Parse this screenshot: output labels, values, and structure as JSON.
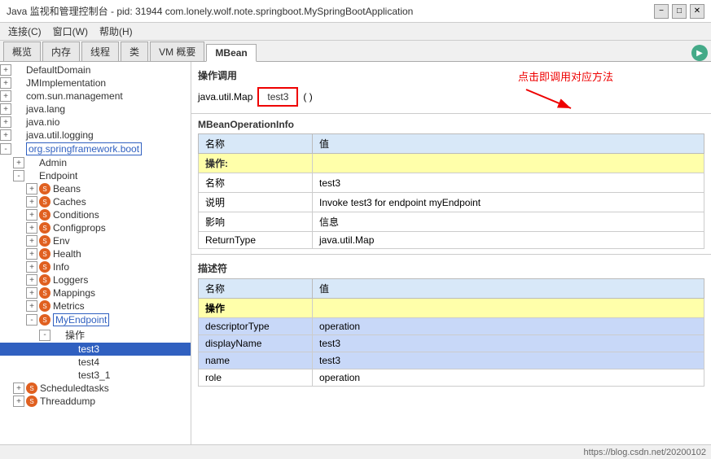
{
  "titleBar": {
    "title": "Java 监视和管理控制台 - pid: 31944 com.lonely.wolf.note.springboot.MySpringBootApplication",
    "minBtn": "−",
    "maxBtn": "□",
    "closeBtn": "✕"
  },
  "menuBar": {
    "items": [
      {
        "label": "连接(C)",
        "id": "connect"
      },
      {
        "label": "窗口(W)",
        "id": "window"
      },
      {
        "label": "帮助(H)",
        "id": "help"
      }
    ]
  },
  "tabs": [
    {
      "label": "概览",
      "id": "overview",
      "active": false
    },
    {
      "label": "内存",
      "id": "memory",
      "active": false
    },
    {
      "label": "线程",
      "id": "threads",
      "active": false
    },
    {
      "label": "类",
      "id": "classes",
      "active": false
    },
    {
      "label": "VM 概要",
      "id": "vm",
      "active": false
    },
    {
      "label": "MBean",
      "id": "mbean",
      "active": true
    }
  ],
  "sidebar": {
    "nodes": [
      {
        "id": "n1",
        "indent": 0,
        "toggle": "+",
        "icon": false,
        "label": "DefaultDomain",
        "selected": false,
        "boxed": false
      },
      {
        "id": "n2",
        "indent": 0,
        "toggle": "+",
        "icon": false,
        "label": "JMImplementation",
        "selected": false,
        "boxed": false
      },
      {
        "id": "n3",
        "indent": 0,
        "toggle": "+",
        "icon": false,
        "label": "com.sun.management",
        "selected": false,
        "boxed": false
      },
      {
        "id": "n4",
        "indent": 0,
        "toggle": "+",
        "icon": false,
        "label": "java.lang",
        "selected": false,
        "boxed": false
      },
      {
        "id": "n5",
        "indent": 0,
        "toggle": "+",
        "icon": false,
        "label": "java.nio",
        "selected": false,
        "boxed": false
      },
      {
        "id": "n6",
        "indent": 0,
        "toggle": "+",
        "icon": false,
        "label": "java.util.logging",
        "selected": false,
        "boxed": false
      },
      {
        "id": "n7",
        "indent": 0,
        "toggle": "-",
        "icon": false,
        "label": "org.springframework.boot",
        "selected": false,
        "boxed": true
      },
      {
        "id": "n8",
        "indent": 1,
        "toggle": "+",
        "icon": false,
        "label": "Admin",
        "selected": false,
        "boxed": false
      },
      {
        "id": "n9",
        "indent": 1,
        "toggle": "-",
        "icon": false,
        "label": "Endpoint",
        "selected": false,
        "boxed": false
      },
      {
        "id": "n10",
        "indent": 2,
        "toggle": "+",
        "icon": true,
        "label": "Beans",
        "selected": false,
        "boxed": false
      },
      {
        "id": "n11",
        "indent": 2,
        "toggle": "+",
        "icon": true,
        "label": "Caches",
        "selected": false,
        "boxed": false
      },
      {
        "id": "n12",
        "indent": 2,
        "toggle": "+",
        "icon": true,
        "label": "Conditions",
        "selected": false,
        "boxed": false
      },
      {
        "id": "n13",
        "indent": 2,
        "toggle": "+",
        "icon": true,
        "label": "Configprops",
        "selected": false,
        "boxed": false
      },
      {
        "id": "n14",
        "indent": 2,
        "toggle": "+",
        "icon": true,
        "label": "Env",
        "selected": false,
        "boxed": false
      },
      {
        "id": "n15",
        "indent": 2,
        "toggle": "+",
        "icon": true,
        "label": "Health",
        "selected": false,
        "boxed": false
      },
      {
        "id": "n16",
        "indent": 2,
        "toggle": "+",
        "icon": true,
        "label": "Info",
        "selected": false,
        "boxed": false
      },
      {
        "id": "n17",
        "indent": 2,
        "toggle": "+",
        "icon": true,
        "label": "Loggers",
        "selected": false,
        "boxed": false
      },
      {
        "id": "n18",
        "indent": 2,
        "toggle": "+",
        "icon": true,
        "label": "Mappings",
        "selected": false,
        "boxed": false
      },
      {
        "id": "n19",
        "indent": 2,
        "toggle": "+",
        "icon": true,
        "label": "Metrics",
        "selected": false,
        "boxed": false
      },
      {
        "id": "n20",
        "indent": 2,
        "toggle": "-",
        "icon": true,
        "label": "MyEndpoint",
        "selected": false,
        "boxed": true
      },
      {
        "id": "n21",
        "indent": 3,
        "toggle": "-",
        "icon": false,
        "label": "操作",
        "selected": false,
        "boxed": false
      },
      {
        "id": "n22",
        "indent": 4,
        "toggle": null,
        "icon": false,
        "label": "test3",
        "selected": true,
        "boxed": false
      },
      {
        "id": "n23",
        "indent": 4,
        "toggle": null,
        "icon": false,
        "label": "test4",
        "selected": false,
        "boxed": false
      },
      {
        "id": "n24",
        "indent": 4,
        "toggle": null,
        "icon": false,
        "label": "test3_1",
        "selected": false,
        "boxed": false
      },
      {
        "id": "n25",
        "indent": 1,
        "toggle": "+",
        "icon": true,
        "label": "Scheduledtasks",
        "selected": false,
        "boxed": false
      },
      {
        "id": "n26",
        "indent": 1,
        "toggle": "+",
        "icon": true,
        "label": "Threaddump",
        "selected": false,
        "boxed": false
      }
    ]
  },
  "content": {
    "opSection": {
      "title": "操作调用",
      "returnType": "java.util.Map",
      "buttonLabel": "test3",
      "paren": "( )",
      "annotation": "点击即调用对应方法"
    },
    "mbeanSection": {
      "title": "MBeanOperationInfo",
      "tableHeaders": [
        "名称",
        "值"
      ],
      "rows": [
        {
          "type": "section",
          "col1": "操作:",
          "col2": ""
        },
        {
          "type": "normal",
          "col1": "名称",
          "col2": "test3"
        },
        {
          "type": "normal",
          "col1": "说明",
          "col2": "Invoke test3 for endpoint myEndpoint"
        },
        {
          "type": "normal",
          "col1": "影响",
          "col2": "信息"
        },
        {
          "type": "normal",
          "col1": "ReturnType",
          "col2": "java.util.Map"
        }
      ]
    },
    "descriptorSection": {
      "title": "描述符",
      "tableHeaders": [
        "名称",
        "值"
      ],
      "rows": [
        {
          "type": "section",
          "col1": "操作",
          "col2": ""
        },
        {
          "type": "highlight",
          "col1": "descriptorType",
          "col2": "operation"
        },
        {
          "type": "highlight",
          "col1": "displayName",
          "col2": "test3"
        },
        {
          "type": "highlight",
          "col1": "name",
          "col2": "test3"
        },
        {
          "type": "normal",
          "col1": "role",
          "col2": "operation"
        }
      ]
    }
  },
  "statusBar": {
    "url": "https://blog.csdn.net/20200102"
  }
}
